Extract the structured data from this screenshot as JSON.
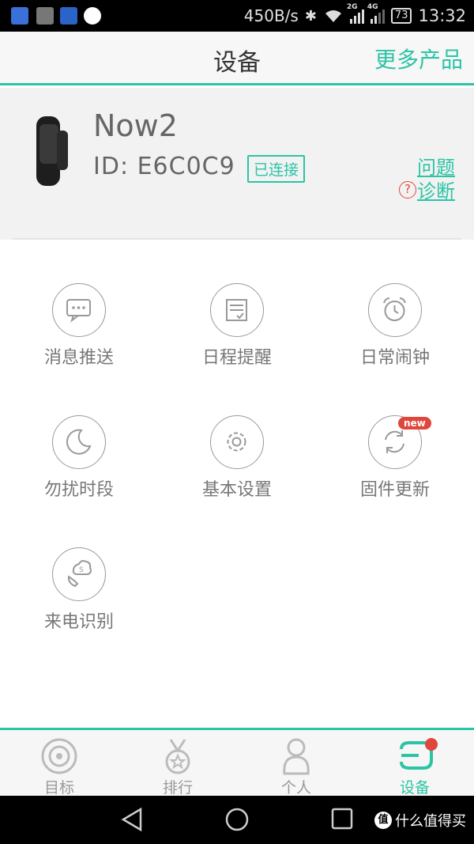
{
  "status_bar": {
    "net_speed": "450B/s",
    "network_2g": "2G",
    "network_4g": "4G",
    "battery": "73",
    "time": "13:32"
  },
  "header": {
    "title": "设备",
    "more_products": "更多产品"
  },
  "device": {
    "name": "Now2",
    "id": "ID: E6C0C9",
    "status": "已连接",
    "diagnose_icon": "?",
    "diagnose": "问题诊断"
  },
  "grid": {
    "items": [
      {
        "label": "消息推送",
        "icon": "message-icon"
      },
      {
        "label": "日程提醒",
        "icon": "schedule-icon"
      },
      {
        "label": "日常闹钟",
        "icon": "alarm-icon"
      },
      {
        "label": "勿扰时段",
        "icon": "moon-icon"
      },
      {
        "label": "基本设置",
        "icon": "gear-icon"
      },
      {
        "label": "固件更新",
        "icon": "refresh-icon"
      },
      {
        "label": "来电识别",
        "icon": "call-icon"
      }
    ],
    "new_badge": "new"
  },
  "bottom_nav": {
    "items": [
      {
        "label": "目标",
        "icon": "target-icon"
      },
      {
        "label": "排行",
        "icon": "medal-icon"
      },
      {
        "label": "个人",
        "icon": "person-icon"
      },
      {
        "label": "设备",
        "icon": "band-icon"
      }
    ],
    "active": "设备"
  },
  "watermark": {
    "logo": "值",
    "text": "什么值得买"
  },
  "colors": {
    "accent": "#2bc4a5",
    "alert": "#e0473c"
  }
}
